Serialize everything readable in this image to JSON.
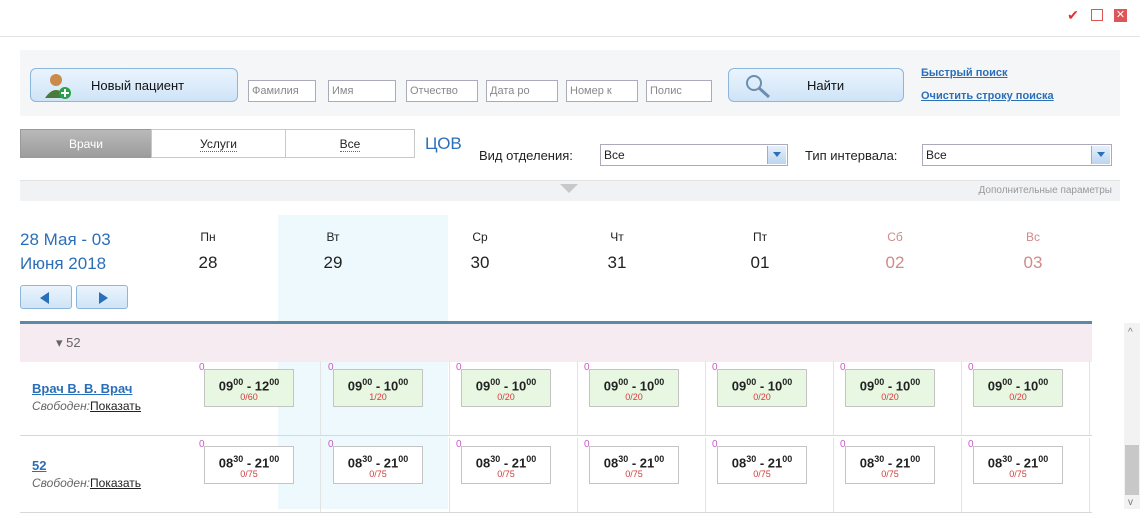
{
  "window": {
    "check_icon": "check-icon",
    "minimize_icon": "minimize-icon",
    "close_icon": "close-icon"
  },
  "search": {
    "new_patient_label": "Новый пациент",
    "fields": [
      "Фамилия",
      "Имя",
      "Отчество",
      "Дата ро",
      "Номер к",
      "Полис"
    ],
    "find_label": "Найти",
    "quick_search": "Быстрый поиск",
    "clear_search": "Очистить строку поиска"
  },
  "tabs": [
    {
      "label": "Врачи",
      "active": true
    },
    {
      "label": "Услуги",
      "active": false
    },
    {
      "label": "Все",
      "active": false
    }
  ],
  "filters": {
    "tsov_label": "ЦОВ",
    "dept_type_label": "Вид отделения:",
    "dept_type_value": "Все",
    "interval_type_label": "Тип интервала:",
    "interval_type_value": "Все",
    "extra_params": "Дополнительные параметры"
  },
  "calendar": {
    "range_line1": "28 Мая - 03",
    "range_line2": "Июня 2018",
    "days": [
      {
        "name": "Пн",
        "num": "28",
        "weekend": false
      },
      {
        "name": "Вт",
        "num": "29",
        "weekend": false,
        "today": true
      },
      {
        "name": "Ср",
        "num": "30",
        "weekend": false
      },
      {
        "name": "Чт",
        "num": "31",
        "weekend": false
      },
      {
        "name": "Пт",
        "num": "01",
        "weekend": false
      },
      {
        "name": "Сб",
        "num": "02",
        "weekend": true
      },
      {
        "name": "Вс",
        "num": "03",
        "weekend": true
      }
    ]
  },
  "group": {
    "label": "52"
  },
  "rows": [
    {
      "name": "Врач В. В. Врач",
      "status": "Свободен:",
      "show": "Показать",
      "style": "green",
      "slots": [
        {
          "zero": "0",
          "h1": "09",
          "m1": "00",
          "h2": "12",
          "m2": "00",
          "count": "0/60"
        },
        {
          "zero": "0",
          "h1": "09",
          "m1": "00",
          "h2": "10",
          "m2": "00",
          "count": "1/20"
        },
        {
          "zero": "0",
          "h1": "09",
          "m1": "00",
          "h2": "10",
          "m2": "00",
          "count": "0/20"
        },
        {
          "zero": "0",
          "h1": "09",
          "m1": "00",
          "h2": "10",
          "m2": "00",
          "count": "0/20"
        },
        {
          "zero": "0",
          "h1": "09",
          "m1": "00",
          "h2": "10",
          "m2": "00",
          "count": "0/20"
        },
        {
          "zero": "0",
          "h1": "09",
          "m1": "00",
          "h2": "10",
          "m2": "00",
          "count": "0/20"
        },
        {
          "zero": "0",
          "h1": "09",
          "m1": "00",
          "h2": "10",
          "m2": "00",
          "count": "0/20"
        }
      ]
    },
    {
      "name": "52",
      "status": "Свободен:",
      "show": "Показать",
      "style": "white",
      "slots": [
        {
          "zero": "0",
          "h1": "08",
          "m1": "30",
          "h2": "21",
          "m2": "00",
          "count": "0/75"
        },
        {
          "zero": "0",
          "h1": "08",
          "m1": "30",
          "h2": "21",
          "m2": "00",
          "count": "0/75"
        },
        {
          "zero": "0",
          "h1": "08",
          "m1": "30",
          "h2": "21",
          "m2": "00",
          "count": "0/75"
        },
        {
          "zero": "0",
          "h1": "08",
          "m1": "30",
          "h2": "21",
          "m2": "00",
          "count": "0/75"
        },
        {
          "zero": "0",
          "h1": "08",
          "m1": "30",
          "h2": "21",
          "m2": "00",
          "count": "0/75"
        },
        {
          "zero": "0",
          "h1": "08",
          "m1": "30",
          "h2": "21",
          "m2": "00",
          "count": "0/75"
        },
        {
          "zero": "0",
          "h1": "08",
          "m1": "30",
          "h2": "21",
          "m2": "00",
          "count": "0/75"
        }
      ]
    }
  ]
}
